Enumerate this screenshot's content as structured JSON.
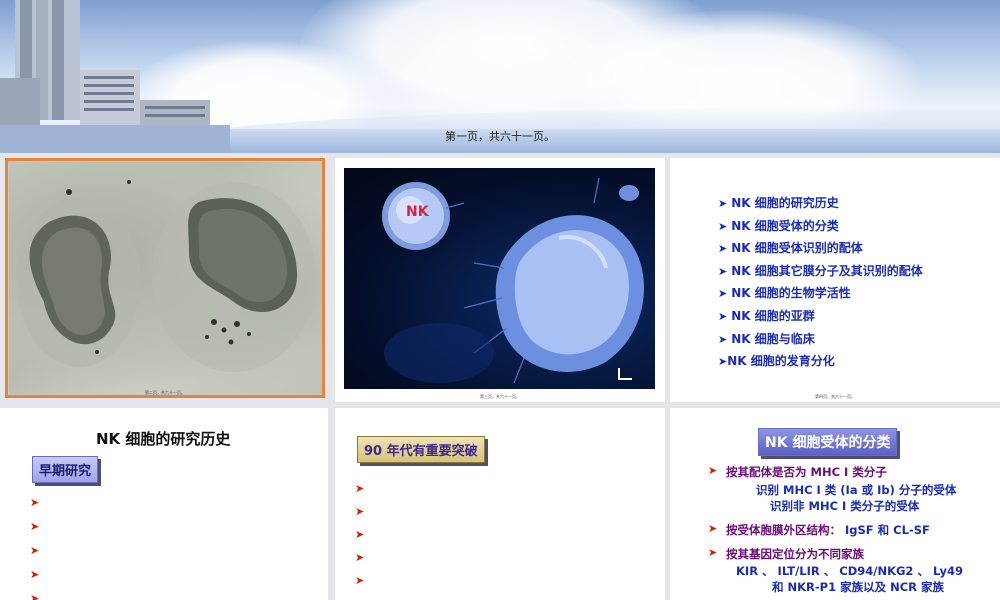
{
  "header": {
    "caption": "第一页，共六十一页。"
  },
  "slide2": {
    "foot": "第二页，共六十一页。"
  },
  "slide3": {
    "label": "NK",
    "foot": "第三页，共六十一页。"
  },
  "slide4": {
    "items": [
      "NK 细胞的研究历史",
      "NK 细胞受体的分类",
      "NK 细胞受体识别的配体",
      "NK 细胞其它膜分子及其识别的配体",
      "NK 细胞的生物学活性",
      "NK 细胞的亚群",
      "NK 细胞与临床",
      "NK 细胞的发育分化"
    ],
    "foot": "第四页，共六十一页。"
  },
  "slide5": {
    "title": "NK 细胞的研究历史",
    "tag": "早期研究"
  },
  "slide6": {
    "tag": "90 年代有重要突破"
  },
  "slide7": {
    "tag": "NK 细胞受体的分类",
    "b1": "按其配体是否为 MHC I 类分子",
    "b1a": "识别 MHC I 类 (Ia 或 Ib) 分子的受体",
    "b1b": "识别非 MHC I 类分子的受体",
    "b2": "按受体胞膜外区结构：",
    "b2v": "IgSF 和 CL-SF",
    "b3": "按其基因定位分为不同家族",
    "b3a": "KIR 、 ILT/LIR 、 CD94/NKG2 、 Ly49",
    "b3b": "和 NKR-P1 家族以及 NCR 家族"
  },
  "colors": {
    "selection": "#e8843a",
    "accent_blue": "#1a2bb5",
    "bullet_red": "#cc2200"
  }
}
